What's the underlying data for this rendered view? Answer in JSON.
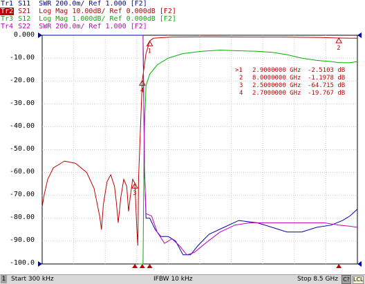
{
  "traces": [
    {
      "id": "tr1",
      "label": "Tr1",
      "text": " S11  SWR 200.0m/ Ref 1.000 [F2]",
      "color": "#0000b0"
    },
    {
      "id": "tr2",
      "label": "Tr2",
      "text": " S21  Log Mag 10.00dB/ Ref 0.000dB [F2]",
      "color": "#c00000"
    },
    {
      "id": "tr3",
      "label": "Tr3",
      "text": " S12  Log Mag 1.000dB/ Ref 0.000dB [F2]",
      "color": "#00b000"
    },
    {
      "id": "tr4",
      "label": "Tr4",
      "text": " S22  SWR 200.0m/ Ref 1.000 [F2]",
      "color": "#c000c0"
    }
  ],
  "y_axis": {
    "labels": [
      "0.000",
      "-10.00",
      "-20.00",
      "-30.00",
      "-40.00",
      "-50.00",
      "-60.00",
      "-70.00",
      "-80.00",
      "-90.00",
      "-100.0"
    ]
  },
  "markers": {
    "readout": [
      {
        "num": ">1",
        "freq": "2.9000000 GHz",
        "value": "-2.5103 dB"
      },
      {
        "num": "2",
        "freq": "8.0000000 GHz",
        "value": "-1.1978 dB"
      },
      {
        "num": "3",
        "freq": "2.5000000 GHz",
        "value": "-64.715 dB"
      },
      {
        "num": "4",
        "freq": "2.7000000 GHz",
        "value": "-19.767 dB"
      }
    ]
  },
  "status": {
    "channel": "1",
    "start": "Start 300 kHz",
    "ifbw": "IFBW 10 kHz",
    "stop": "Stop 8.5 GHz",
    "c_button": "C?",
    "l_button": "LCL"
  },
  "chart_data": {
    "type": "line",
    "xlim": [
      0.0003,
      8.5
    ],
    "ylim": [
      -100,
      0
    ],
    "series": [
      {
        "name": "S21",
        "color": "#c00000",
        "points": [
          [
            0.0003,
            -75
          ],
          [
            0.05,
            -70
          ],
          [
            0.15,
            -63
          ],
          [
            0.3,
            -58
          ],
          [
            0.6,
            -55
          ],
          [
            0.9,
            -56
          ],
          [
            1.2,
            -60
          ],
          [
            1.4,
            -67
          ],
          [
            1.55,
            -79
          ],
          [
            1.6,
            -85
          ],
          [
            1.65,
            -74
          ],
          [
            1.75,
            -64
          ],
          [
            1.85,
            -61
          ],
          [
            1.95,
            -66
          ],
          [
            2.0,
            -73
          ],
          [
            2.05,
            -82
          ],
          [
            2.12,
            -71
          ],
          [
            2.2,
            -63
          ],
          [
            2.28,
            -66
          ],
          [
            2.33,
            -77
          ],
          [
            2.38,
            -70
          ],
          [
            2.44,
            -63
          ],
          [
            2.5,
            -64.7
          ],
          [
            2.55,
            -84
          ],
          [
            2.58,
            -92
          ],
          [
            2.6,
            -62
          ],
          [
            2.7,
            -19.8
          ],
          [
            2.8,
            -8
          ],
          [
            2.9,
            -2.5
          ],
          [
            3.0,
            -1.3
          ],
          [
            3.5,
            -0.8
          ],
          [
            4.5,
            -0.7
          ],
          [
            5.5,
            -0.8
          ],
          [
            6.5,
            -0.8
          ],
          [
            7.5,
            -1
          ],
          [
            8.0,
            -1.2
          ],
          [
            8.5,
            -1.3
          ]
        ]
      },
      {
        "name": "S12",
        "color": "#00b000",
        "points": [
          [
            2.6,
            -100
          ],
          [
            2.72,
            -100
          ],
          [
            2.75,
            -45
          ],
          [
            2.8,
            -22
          ],
          [
            2.9,
            -17
          ],
          [
            3.1,
            -13
          ],
          [
            3.4,
            -10
          ],
          [
            3.8,
            -8
          ],
          [
            4.3,
            -7
          ],
          [
            4.8,
            -6.5
          ],
          [
            5.3,
            -6.8
          ],
          [
            5.8,
            -7
          ],
          [
            6.2,
            -7.5
          ],
          [
            6.6,
            -8.5
          ],
          [
            7.0,
            -10
          ],
          [
            7.4,
            -11
          ],
          [
            7.8,
            -11.5
          ],
          [
            8.0,
            -12
          ],
          [
            8.3,
            -12
          ],
          [
            8.5,
            -11.5
          ]
        ]
      },
      {
        "name": "S11",
        "color": "#0000b0",
        "points": [
          [
            0.0003,
            0
          ],
          [
            2.55,
            0
          ],
          [
            2.72,
            0
          ],
          [
            2.76,
            -60
          ],
          [
            2.8,
            -80
          ],
          [
            2.9,
            -80
          ],
          [
            3.05,
            -85
          ],
          [
            3.2,
            -88
          ],
          [
            3.4,
            -88
          ],
          [
            3.6,
            -90
          ],
          [
            3.8,
            -96
          ],
          [
            4.0,
            -96
          ],
          [
            4.2,
            -92
          ],
          [
            4.5,
            -87
          ],
          [
            4.9,
            -84
          ],
          [
            5.3,
            -81
          ],
          [
            5.8,
            -82
          ],
          [
            6.2,
            -84
          ],
          [
            6.6,
            -86
          ],
          [
            7.0,
            -86
          ],
          [
            7.4,
            -84
          ],
          [
            7.8,
            -83
          ],
          [
            8.1,
            -81
          ],
          [
            8.3,
            -79
          ],
          [
            8.5,
            -76
          ]
        ]
      },
      {
        "name": "S22",
        "color": "#c000c0",
        "points": [
          [
            2.72,
            0
          ],
          [
            2.76,
            -60
          ],
          [
            2.8,
            -78
          ],
          [
            2.95,
            -79
          ],
          [
            3.1,
            -86
          ],
          [
            3.3,
            -91
          ],
          [
            3.5,
            -89
          ],
          [
            3.7,
            -92
          ],
          [
            3.9,
            -96
          ],
          [
            4.1,
            -95
          ],
          [
            4.4,
            -91
          ],
          [
            4.8,
            -86
          ],
          [
            5.2,
            -83
          ],
          [
            5.6,
            -82
          ],
          [
            6.0,
            -82
          ],
          [
            6.4,
            -82
          ],
          [
            6.8,
            -82
          ],
          [
            7.2,
            -82
          ],
          [
            7.6,
            -82
          ],
          [
            8.0,
            -83
          ],
          [
            8.3,
            -83.5
          ],
          [
            8.5,
            -84
          ]
        ]
      }
    ],
    "marker_points": [
      {
        "n": "1",
        "x": 2.9,
        "y": -2.5103,
        "color": "#c00000"
      },
      {
        "n": "2",
        "x": 8.0,
        "y": -1.1978,
        "color": "#c00000"
      },
      {
        "n": "3",
        "x": 2.5,
        "y": -64.715,
        "color": "#c00000"
      },
      {
        "n": "4",
        "x": 2.7,
        "y": -19.767,
        "color": "#c00000"
      }
    ]
  }
}
